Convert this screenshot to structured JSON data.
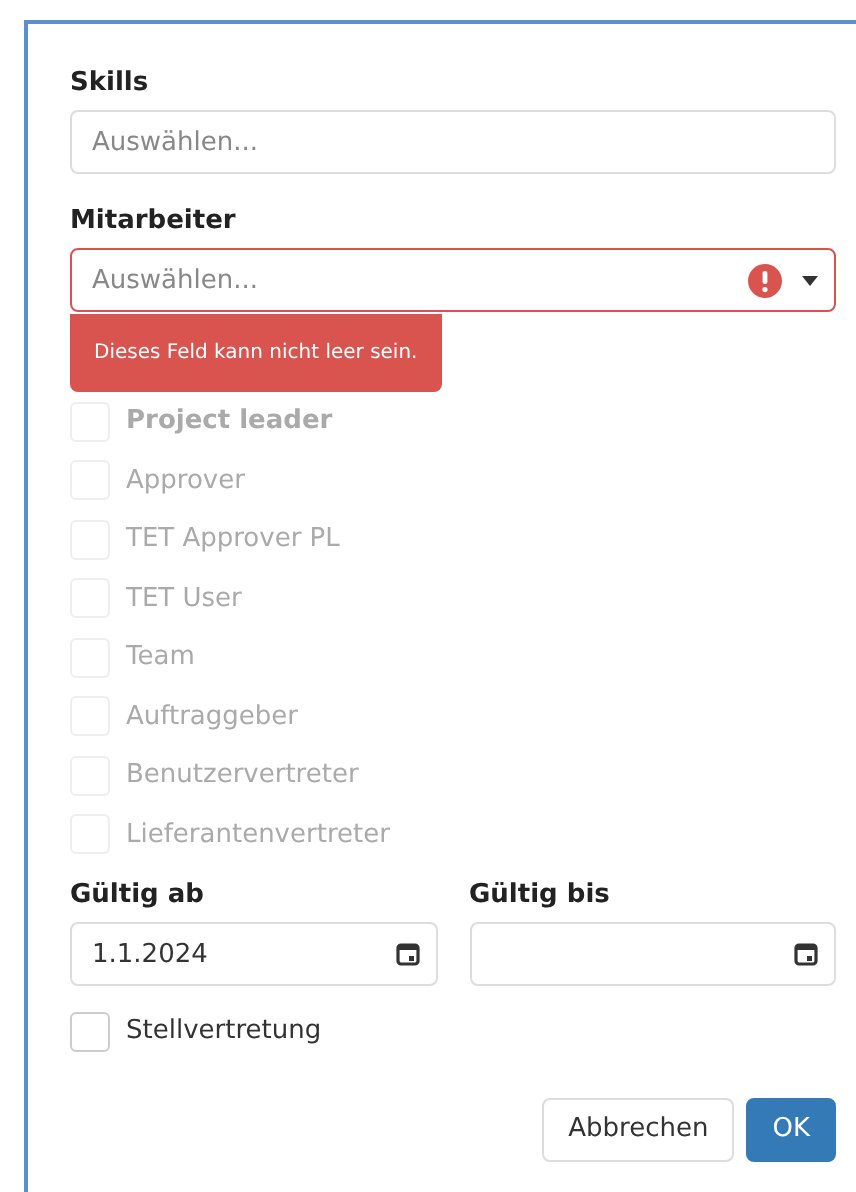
{
  "fields": [
    {
      "label": "Skills",
      "placeholder": "Auswählen...",
      "invalid": false
    },
    {
      "label": "Mitarbeiter",
      "placeholder": "Auswählen...",
      "invalid": true,
      "error": "Dieses Feld kann nicht leer sein."
    }
  ],
  "roles": [
    {
      "label": "Project leader",
      "kind": "group",
      "checked": false,
      "disabled": true
    },
    {
      "label": "Approver",
      "kind": "item",
      "checked": false,
      "disabled": true
    },
    {
      "label": "TET Approver PL",
      "kind": "item",
      "checked": false,
      "disabled": true
    },
    {
      "label": "TET User",
      "kind": "item",
      "checked": false,
      "disabled": true
    },
    {
      "label": "Team",
      "kind": "item",
      "checked": false,
      "disabled": true
    },
    {
      "label": "Auftraggeber",
      "kind": "item",
      "checked": false,
      "disabled": true
    },
    {
      "label": "Benutzervertreter",
      "kind": "item",
      "checked": false,
      "disabled": true
    },
    {
      "label": "Lieferantenvertreter",
      "kind": "item",
      "checked": false,
      "disabled": true
    }
  ],
  "dates": [
    {
      "label": "Gültig ab",
      "value": "1.1.2024"
    },
    {
      "label": "Gültig bis"
    }
  ],
  "substitute": {
    "label": "Stellvertretung",
    "checked": false,
    "disabled": false
  },
  "buttons": [
    {
      "label": "Abbrechen",
      "kind": "secondary"
    },
    {
      "label": "OK",
      "kind": "primary"
    }
  ]
}
